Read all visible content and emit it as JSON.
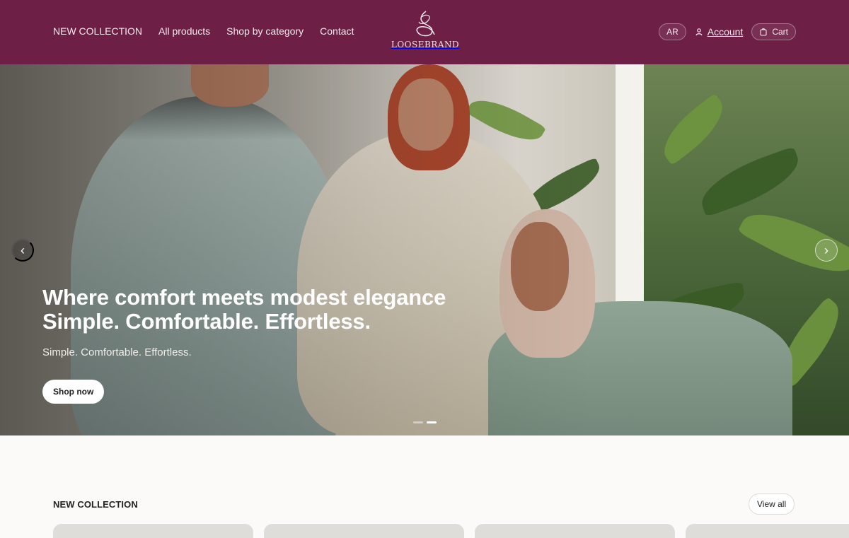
{
  "nav": {
    "items": [
      "NEW COLLECTION",
      "All products",
      "Shop by category",
      "Contact"
    ]
  },
  "logo": {
    "name": "LOOSEBRAND",
    "icon": "script-monogram-logo"
  },
  "header_actions": {
    "language": "AR",
    "account": "Account",
    "cart": "Cart"
  },
  "hero": {
    "title": "Where comfort meets modest elegance Simple. Comfortable. Effortless.",
    "subtitle": "Simple. Comfortable. Effortless.",
    "button": "Shop now",
    "prev_icon": "chevron-left-icon",
    "next_icon": "chevron-right-icon",
    "slides_total": 2,
    "active_slide": 2
  },
  "collection": {
    "title": "NEW COLLECTION",
    "view_all": "View all"
  },
  "colors": {
    "header": "#6e1f46",
    "hero_background": "#bdbbb4",
    "page_background": "#fbfaf9"
  }
}
